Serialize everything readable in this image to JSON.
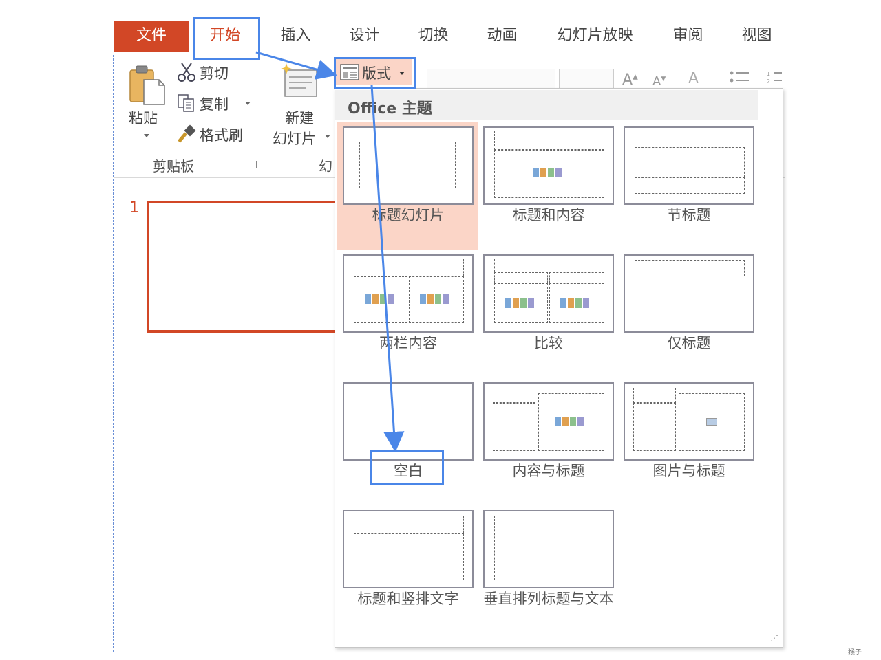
{
  "tabs": [
    {
      "label": "文件",
      "state": "file"
    },
    {
      "label": "开始",
      "state": "active"
    },
    {
      "label": "插入"
    },
    {
      "label": "设计"
    },
    {
      "label": "切换"
    },
    {
      "label": "动画"
    },
    {
      "label": "幻灯片放映"
    },
    {
      "label": "审阅"
    },
    {
      "label": "视图"
    }
  ],
  "clipboard": {
    "paste_label": "粘贴",
    "cut_label": "剪切",
    "copy_label": "复制",
    "format_painter_label": "格式刷",
    "group_label": "剪贴板"
  },
  "slides_group": {
    "new_slide_label_line1": "新建",
    "new_slide_label_line2": "幻灯片",
    "layout_button_label": "版式",
    "group_label_partial": "幻"
  },
  "layout_gallery": {
    "header": "Office 主题",
    "selected_index": 0,
    "items": [
      {
        "label": "标题幻灯片",
        "icon": "layout-title-slide"
      },
      {
        "label": "标题和内容",
        "icon": "layout-title-content"
      },
      {
        "label": "节标题",
        "icon": "layout-section-header"
      },
      {
        "label": "两栏内容",
        "icon": "layout-two-content"
      },
      {
        "label": "比较",
        "icon": "layout-comparison"
      },
      {
        "label": "仅标题",
        "icon": "layout-title-only"
      },
      {
        "label": "空白",
        "icon": "layout-blank"
      },
      {
        "label": "内容与标题",
        "icon": "layout-content-caption"
      },
      {
        "label": "图片与标题",
        "icon": "layout-picture-caption"
      },
      {
        "label": "标题和竖排文字",
        "icon": "layout-title-vertical-text"
      },
      {
        "label": "垂直排列标题与文本",
        "icon": "layout-vertical-title-text"
      }
    ]
  },
  "slide_pane": {
    "slide_number": "1"
  },
  "watermark": "猴子",
  "colors": {
    "accent": "#d24726",
    "annotation": "#4a86e8",
    "selected": "#fbd5c7"
  }
}
